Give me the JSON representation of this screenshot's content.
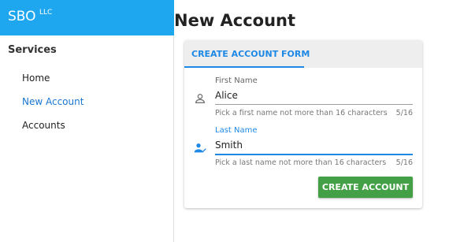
{
  "brand": {
    "name": "SBO",
    "suffix": "LLC",
    "color": "#1ea7ef"
  },
  "sidebar": {
    "title": "Services",
    "items": [
      {
        "label": "Home",
        "active": false
      },
      {
        "label": "New Account",
        "active": true
      },
      {
        "label": "Accounts",
        "active": false
      }
    ]
  },
  "page": {
    "title": "New Account"
  },
  "card": {
    "tab_label": "CREATE ACCOUNT FORM",
    "fields": [
      {
        "label": "First Name",
        "value": "Alice",
        "hint": "Pick a first name not more than 16 characters",
        "counter": "5/16",
        "icon": "person-icon"
      },
      {
        "label": "Last Name",
        "value": "Smith",
        "hint": "Pick a last name not more than 16 characters",
        "counter": "5/16",
        "icon": "person-check-icon"
      }
    ],
    "submit_label": "CREATE ACCOUNT"
  },
  "colors": {
    "accent": "#1e88e5",
    "submit": "#43a047"
  }
}
